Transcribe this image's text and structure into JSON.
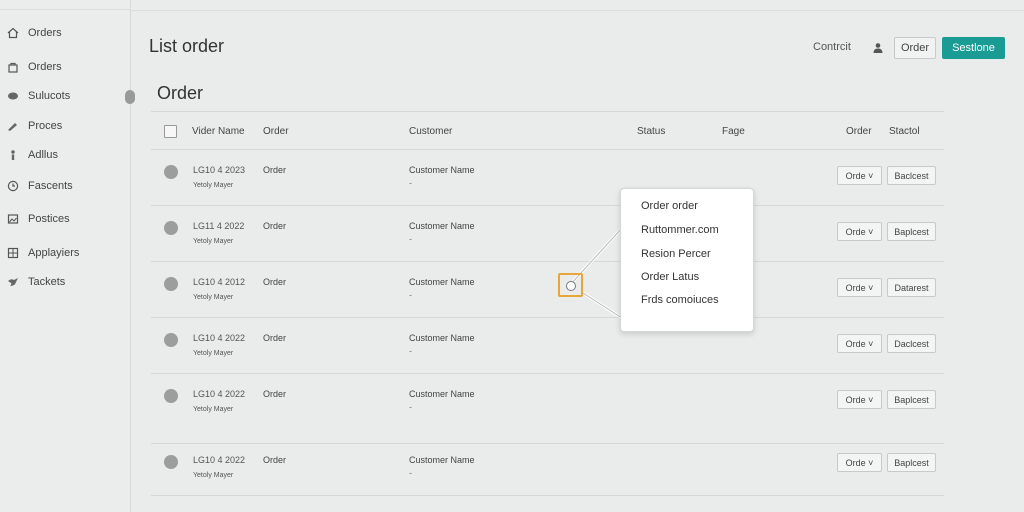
{
  "sidebar": {
    "items": [
      {
        "label": "Orders",
        "icon": "home-icon"
      },
      {
        "label": "Orders",
        "icon": "bag-icon"
      },
      {
        "label": "Sulucots",
        "icon": "chat-icon"
      },
      {
        "label": "Proces",
        "icon": "pen-icon"
      },
      {
        "label": "Adllus",
        "icon": "person-icon"
      },
      {
        "label": "Fascents",
        "icon": "clock-icon"
      },
      {
        "label": "Postices",
        "icon": "image-icon"
      },
      {
        "label": "Applayiers",
        "icon": "grid-icon"
      },
      {
        "label": "Tackets",
        "icon": "bird-icon"
      }
    ]
  },
  "header": {
    "title": "List order",
    "link": "Contrcit",
    "order_button": "Order",
    "primary_button": "Sestlone",
    "accent_color": "#1a9c95"
  },
  "table": {
    "title": "Order",
    "columns": [
      "Vider Name",
      "Order",
      "Customer",
      "Status",
      "Fage",
      "Order",
      "Stactol"
    ],
    "rows": [
      {
        "code": "LG10 4 2023",
        "name": "Yetoly Mayer",
        "order": "Order",
        "customer": "Customer Name",
        "dash": "-",
        "select": "Orde ˅",
        "action": "Baclcest"
      },
      {
        "code": "LG11 4 2022",
        "name": "Yetoly Mayer",
        "order": "Order",
        "customer": "Customer Name",
        "dash": "-",
        "select": "Orde ˅",
        "action": "Baplcest"
      },
      {
        "code": "LG10 4 2012",
        "name": "Yetoly Mayer",
        "order": "Order",
        "customer": "Customer Name",
        "dash": "-",
        "select": "Orde ˅",
        "action": "Datarest"
      },
      {
        "code": "LG10 4 2022",
        "name": "Yetoly Mayer",
        "order": "Order",
        "customer": "Customer Name",
        "dash": "-",
        "select": "Orde ˅",
        "action": "Daclcest"
      },
      {
        "code": "LG10 4 2022",
        "name": "Yetoly Mayer",
        "order": "Order",
        "customer": "Customer Name",
        "dash": "-",
        "select": "Orde ˅",
        "action": "Baplcest"
      },
      {
        "code": "LG10 4 2022",
        "name": "Yetoly Mayer",
        "order": "Order",
        "customer": "Customer Name",
        "dash": "-",
        "select": "Orde ˅",
        "action": "Baplcest"
      }
    ]
  },
  "popup": {
    "items": [
      "Order order",
      "Ruttommer.com",
      "Resion Percer",
      "Order Latus",
      "Frds comoiuces"
    ]
  },
  "colors": {
    "highlight": "#e8a63a"
  }
}
